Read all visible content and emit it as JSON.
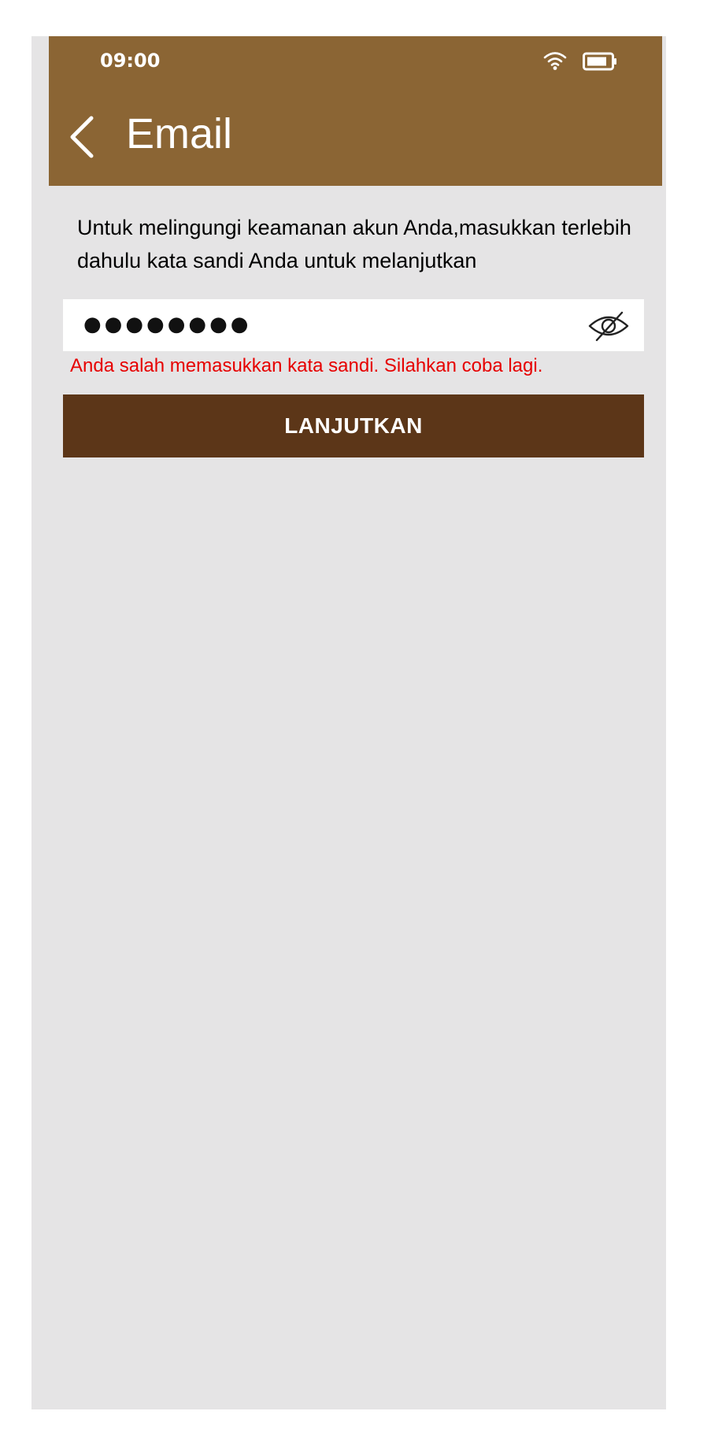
{
  "status_bar": {
    "time": "09:00",
    "icons": [
      "wifi-icon",
      "battery-icon"
    ]
  },
  "header": {
    "back_icon": "chevron-left-icon",
    "title": "Email"
  },
  "main": {
    "instruction": "Untuk melingungi keamanan akun Anda,masukkan terlebih dahulu kata sandi Anda untuk melanjutkan",
    "password_field": {
      "value": "●●●●●●●●",
      "toggle_icon": "eye-slash-icon"
    },
    "error_message": "Anda salah memasukkan kata sandi. Silahkan coba lagi.",
    "submit_label": "LANJUTKAN"
  },
  "colors": {
    "appbar": "#8b6534",
    "background": "#e5e4e5",
    "button": "#5c3618",
    "error": "#e60000"
  }
}
